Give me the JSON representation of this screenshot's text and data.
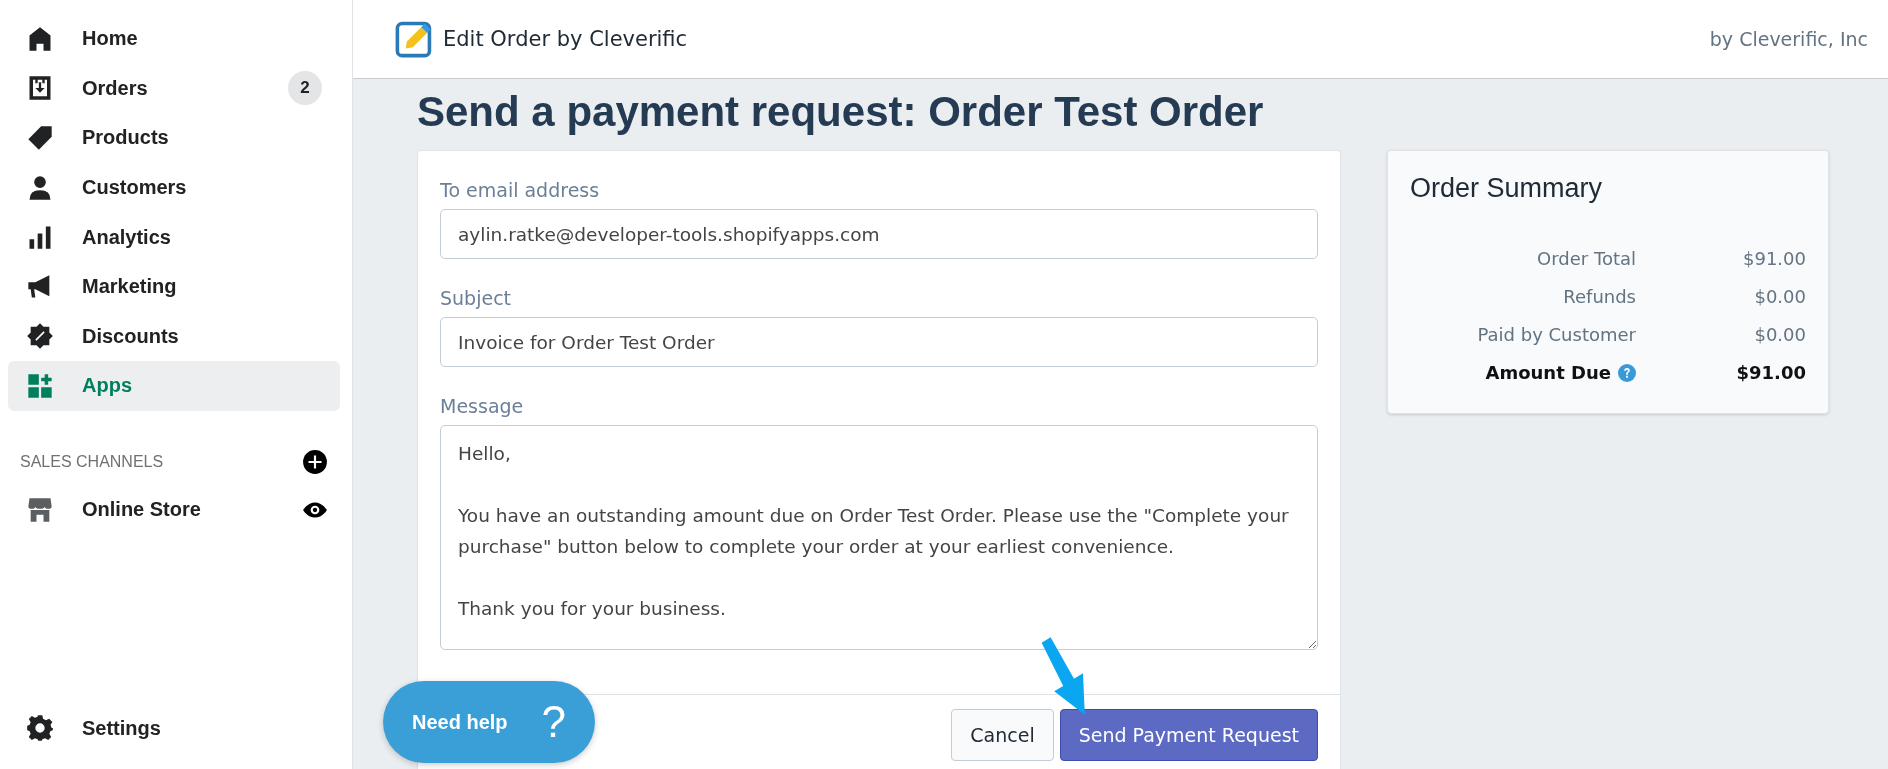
{
  "sidebar": {
    "items": [
      {
        "label": "Home",
        "selected": false
      },
      {
        "label": "Orders",
        "badge": "2",
        "selected": false
      },
      {
        "label": "Products",
        "selected": false
      },
      {
        "label": "Customers",
        "selected": false
      },
      {
        "label": "Analytics",
        "selected": false
      },
      {
        "label": "Marketing",
        "selected": false
      },
      {
        "label": "Discounts",
        "selected": false
      },
      {
        "label": "Apps",
        "selected": true
      }
    ],
    "section_title": "SALES CHANNELS",
    "channels": [
      {
        "label": "Online Store"
      }
    ],
    "footer_item": {
      "label": "Settings"
    }
  },
  "header": {
    "app_name": "Edit Order by Cleverific",
    "vendor": "by Cleverific, Inc"
  },
  "page_title": "Send a payment request: Order Test Order",
  "form": {
    "fields": [
      {
        "label": "To email address",
        "value": "aylin.ratke@developer-tools.shopifyapps.com"
      },
      {
        "label": "Subject",
        "value": "Invoice for Order Test Order"
      }
    ],
    "message": {
      "label": "Message",
      "value": "Hello,\n\nYou have an outstanding amount due on Order Test Order. Please use the \"Complete your purchase\" button below to complete your order at your earliest convenience.\n\nThank you for your business."
    },
    "buttons": [
      {
        "label": "Cancel",
        "kind": "secondary"
      },
      {
        "label": "Send Payment Request",
        "kind": "primary"
      }
    ]
  },
  "summary": {
    "title": "Order Summary",
    "rows": [
      {
        "label": "Order Total",
        "value": "$91.00",
        "bold": false
      },
      {
        "label": "Refunds",
        "value": "$0.00",
        "bold": false
      },
      {
        "label": "Paid by Customer",
        "value": "$0.00",
        "bold": false
      },
      {
        "label": "Amount Due",
        "value": "$91.00",
        "bold": true
      }
    ]
  },
  "help_button": {
    "label": "Need help",
    "icon_text": "?"
  }
}
